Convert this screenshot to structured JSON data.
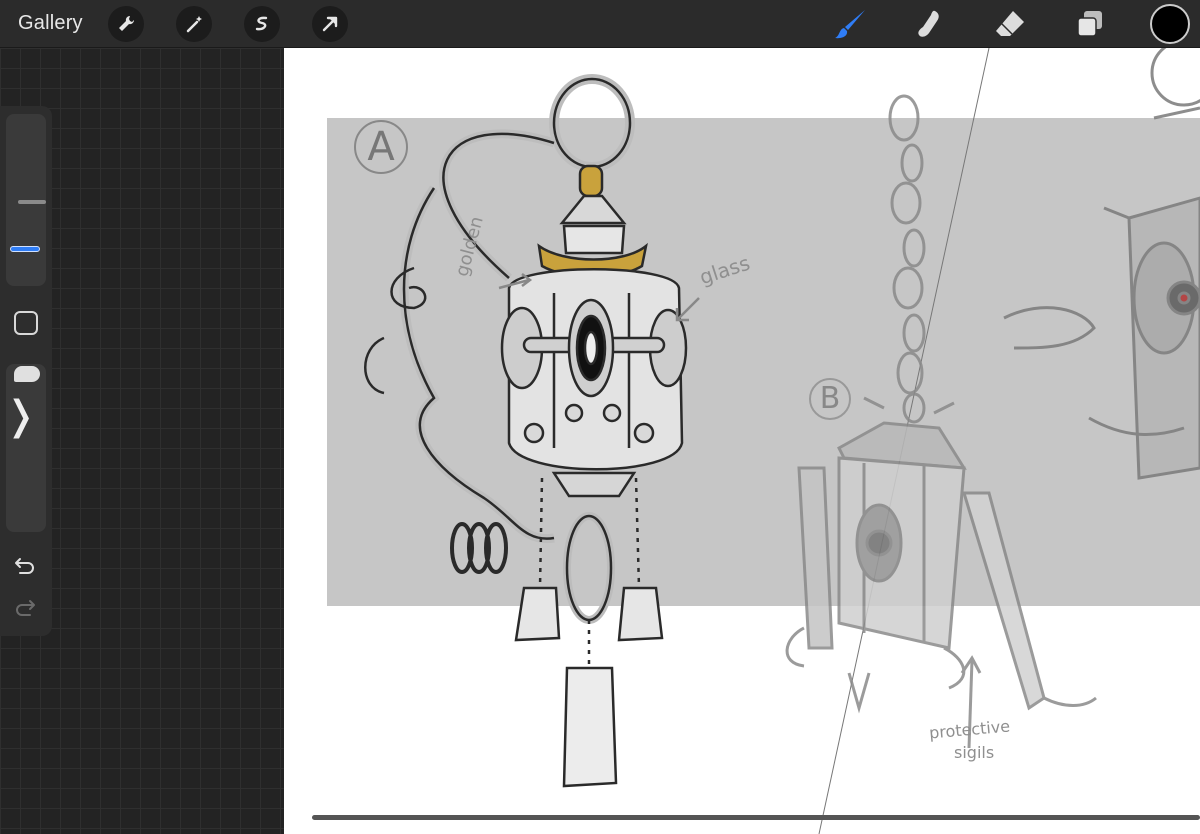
{
  "header": {
    "gallery_label": "Gallery",
    "left_tools": [
      "wrench-icon",
      "magic-wand-icon",
      "selection-icon",
      "transform-arrow-icon"
    ],
    "right_tools": [
      "brush-icon",
      "smudge-icon",
      "eraser-icon",
      "layers-icon"
    ],
    "active_tool": "brush-icon",
    "accent_color": "#2f7df6",
    "current_color": "#000000"
  },
  "sidebar": {
    "icons": [
      "modify-icon",
      "chevron-right-icon",
      "undo-icon",
      "redo-icon"
    ]
  },
  "canvas": {
    "sketch_a_label": "A",
    "sketch_b_label": "B",
    "notes": {
      "golden": "golden",
      "glass": "glass",
      "protective_line1": "protective",
      "protective_line2": "sigils"
    }
  }
}
